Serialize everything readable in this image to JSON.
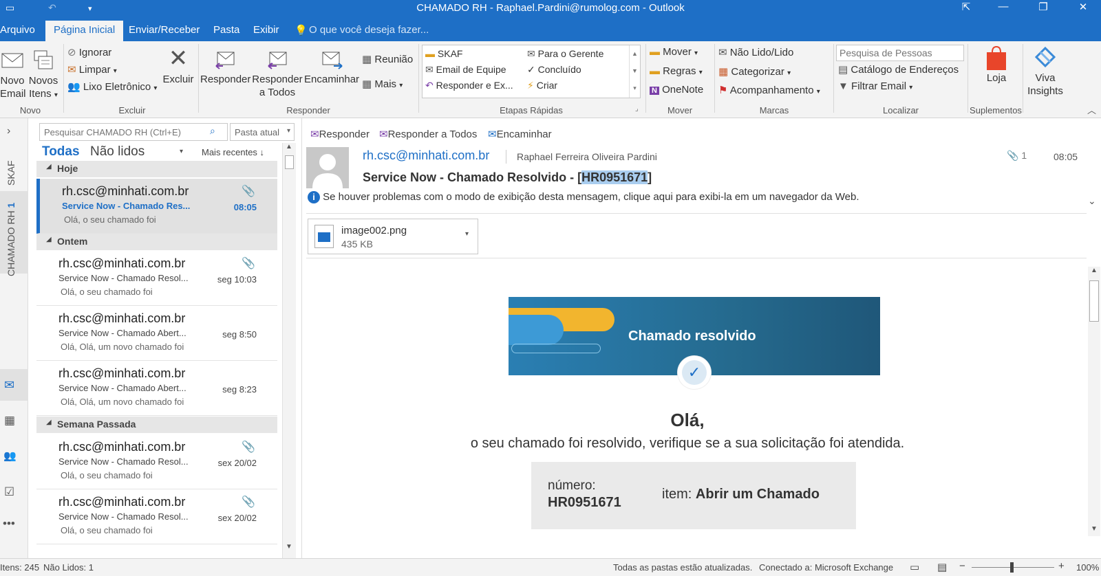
{
  "window": {
    "title": "CHAMADO RH - Raphael.Pardini@rumolog.com - Outlook",
    "accent": "#1e6fc6"
  },
  "tabs": [
    "Arquivo",
    "Página Inicial",
    "Enviar/Receber",
    "Pasta",
    "Exibir"
  ],
  "tell_me": "O que você deseja fazer...",
  "ribbon": {
    "novo": {
      "email_1": "Novo",
      "email_2": "Email",
      "itens_1": "Novos",
      "itens_2": "Itens",
      "group": "Novo"
    },
    "excluir": {
      "ignorar": "Ignorar",
      "limpar": "Limpar",
      "lixo": "Lixo Eletrônico",
      "excluir": "Excluir",
      "group": "Excluir"
    },
    "responder": {
      "responder": "Responder",
      "todos_1": "Responder",
      "todos_2": "a Todos",
      "encaminhar": "Encaminhar",
      "reuniao": "Reunião",
      "mais": "Mais",
      "group": "Responder"
    },
    "etapas": {
      "skaf": "SKAF",
      "email_equipe": "Email de Equipe",
      "resp_ex": "Responder e Ex...",
      "gerente": "Para o Gerente",
      "concluido": "Concluído",
      "criar": "Criar",
      "group": "Etapas Rápidas"
    },
    "mover": {
      "mover": "Mover",
      "regras": "Regras",
      "onenote": "OneNote",
      "group": "Mover"
    },
    "marcas": {
      "nao_lido": "Não Lido/Lido",
      "categorizar": "Categorizar",
      "acompanhamento": "Acompanhamento",
      "group": "Marcas"
    },
    "localizar": {
      "pesquisa_placeholder": "Pesquisa de Pessoas",
      "catalogo": "Catálogo de Endereços",
      "filtrar": "Filtrar Email",
      "group": "Localizar"
    },
    "suplementos": {
      "loja": "Loja",
      "viva_1": "Viva",
      "viva_2": "Insights",
      "group": "Suplementos"
    }
  },
  "nav": {
    "skaf": "SKAF",
    "chamado": "CHAMADO RH",
    "chamado_count": "1"
  },
  "list": {
    "search_placeholder": "Pesquisar CHAMADO RH (Ctrl+E)",
    "scope": "Pasta atual",
    "filter_all": "Todas",
    "filter_unread": "Não lidos",
    "sort": "Mais recentes",
    "groups": {
      "today": "Hoje",
      "yesterday": "Ontem",
      "lastweek": "Semana Passada"
    },
    "mails": [
      {
        "from": "rh.csc@minhati.com.br",
        "subject": "Service Now - Chamado Res...",
        "preview": "Olá,  o seu chamado foi",
        "time": "08:05"
      },
      {
        "from": "rh.csc@minhati.com.br",
        "subject": "Service Now - Chamado Resol...",
        "preview": "Olá,  o seu chamado foi",
        "time": "seg 10:03"
      },
      {
        "from": "rh.csc@minhati.com.br",
        "subject": "Service Now - Chamado Abert...",
        "preview": "Olá,  Olá, um novo chamado foi",
        "time": "seg 8:50"
      },
      {
        "from": "rh.csc@minhati.com.br",
        "subject": "Service Now - Chamado Abert...",
        "preview": "Olá,  Olá, um novo chamado foi",
        "time": "seg 8:23"
      },
      {
        "from": "rh.csc@minhati.com.br",
        "subject": "Service Now - Chamado Resol...",
        "preview": "Olá,  o seu chamado foi",
        "time": "sex 20/02"
      },
      {
        "from": "rh.csc@minhati.com.br",
        "subject": "Service Now - Chamado Resol...",
        "preview": "Olá,  o seu chamado foi",
        "time": "sex 20/02"
      }
    ]
  },
  "reading": {
    "actions": {
      "reply": "Responder",
      "reply_all": "Responder a Todos",
      "forward": "Encaminhar"
    },
    "from": "rh.csc@minhati.com.br",
    "to": "Raphael Ferreira Oliveira Pardini",
    "attach_count": "1",
    "time": "08:05",
    "subject_prefix": "Service Now - Chamado Resolvido - [",
    "subject_id": "HR0951671",
    "subject_suffix": "]",
    "info": "Se houver problemas com o modo de exibição desta mensagem, clique aqui para exibi-la em um navegador da Web.",
    "attachment": {
      "name": "image002.png",
      "size": "435 KB"
    },
    "banner_title": "Chamado resolvido",
    "hello": "Olá,",
    "message": "o seu chamado foi resolvido, verifique se a sua solicitação foi atendida.",
    "numero_label": "número:",
    "numero_value": "HR0951671",
    "item_label": "item:",
    "item_value": "Abrir um Chamado"
  },
  "status": {
    "items": "Itens: 245",
    "unread": "Não Lidos: 1",
    "sync": "Todas as pastas estão atualizadas.",
    "connected": "Conectado a: Microsoft Exchange",
    "zoom": "100%"
  }
}
